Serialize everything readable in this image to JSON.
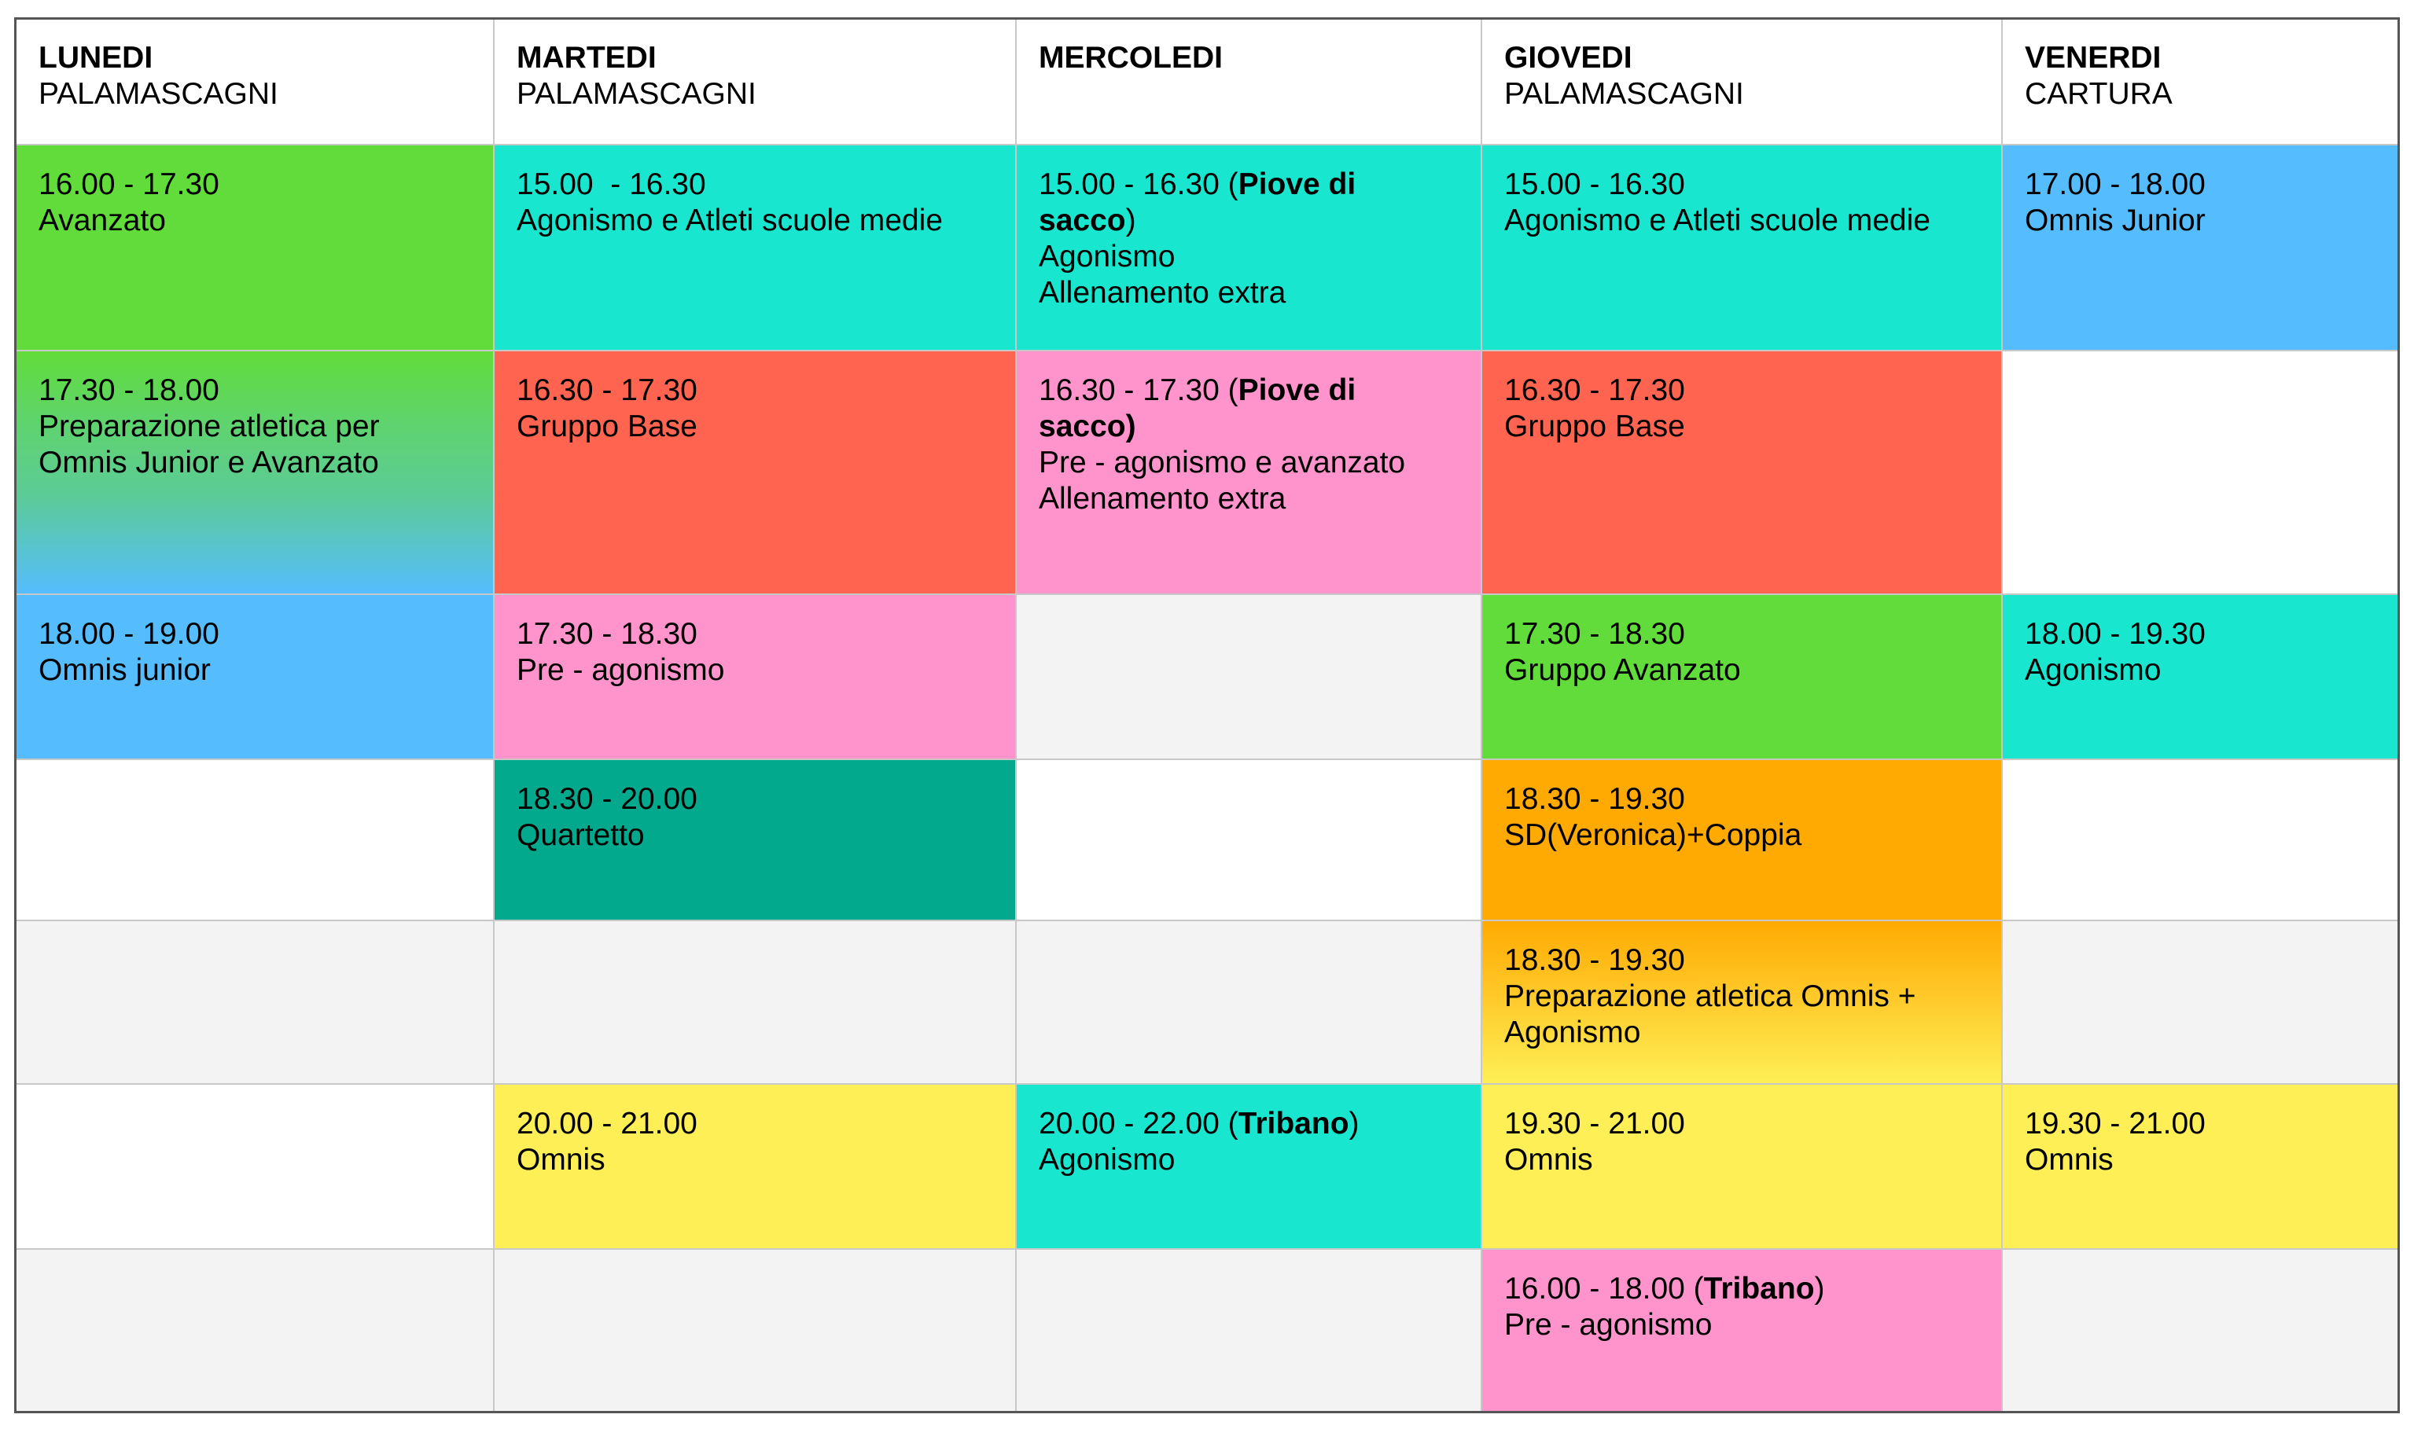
{
  "colors": {
    "green": "#61dc3a",
    "cyan": "#18e6cf",
    "blue": "#55bdfd",
    "red": "#ff6450",
    "pink": "#ff94cc",
    "teal": "#02a98c",
    "orange": "#ffaa02",
    "yellow": "#fdef55",
    "grey": "#f3f3f3",
    "white": "#ffffff",
    "grid_line": "#c8c8c8",
    "outer_border": "#555555"
  },
  "header": [
    {
      "day": "LUNEDI",
      "place": "PALAMASCAGNI"
    },
    {
      "day": "MARTEDI",
      "place": "PALAMASCAGNI"
    },
    {
      "day": "MERCOLEDI",
      "place": ""
    },
    {
      "day": "GIOVEDI",
      "place": "PALAMASCAGNI"
    },
    {
      "day": "VENERDI",
      "place": "CARTURA"
    }
  ],
  "rows": [
    [
      {
        "color": "green",
        "lines": [
          [
            {
              "t": "16.00 - 17.30"
            }
          ],
          [
            {
              "t": "Avanzato"
            }
          ]
        ]
      },
      {
        "color": "cyan",
        "lines": [
          [
            {
              "t": "15.00  - 16.30"
            }
          ],
          [
            {
              "t": "Agonismo e Atleti scuole medie"
            }
          ]
        ]
      },
      {
        "color": "cyan",
        "lines": [
          [
            {
              "t": "15.00 - 16.30 ("
            },
            {
              "t": "Piove di sacco",
              "b": true
            },
            {
              "t": ")"
            }
          ],
          [
            {
              "t": "Agonismo"
            }
          ],
          [
            {
              "t": "Allenamento extra"
            }
          ]
        ]
      },
      {
        "color": "cyan",
        "lines": [
          [
            {
              "t": "15.00 - 16.30"
            }
          ],
          [
            {
              "t": "Agonismo e Atleti scuole medie"
            }
          ]
        ]
      },
      {
        "color": "blue",
        "lines": [
          [
            {
              "t": "17.00 - 18.00"
            }
          ],
          [
            {
              "t": "Omnis Junior"
            }
          ]
        ]
      }
    ],
    [
      {
        "color": "green-blue",
        "lines": [
          [
            {
              "t": "17.30 - 18.00"
            }
          ],
          [
            {
              "t": "Preparazione atletica per Omnis Junior e Avanzato"
            }
          ]
        ]
      },
      {
        "color": "red",
        "lines": [
          [
            {
              "t": "16.30 - 17.30"
            }
          ],
          [
            {
              "t": "Gruppo Base"
            }
          ]
        ]
      },
      {
        "color": "pink",
        "lines": [
          [
            {
              "t": "16.30 - 17.30 ("
            },
            {
              "t": "Piove di sacco)",
              "b": true
            }
          ],
          [
            {
              "t": "Pre - agonismo e avanzato"
            }
          ],
          [
            {
              "t": "Allenamento extra"
            }
          ]
        ]
      },
      {
        "color": "red",
        "lines": [
          [
            {
              "t": "16.30 - 17.30"
            }
          ],
          [
            {
              "t": "Gruppo Base"
            }
          ]
        ]
      },
      {
        "color": "white",
        "lines": []
      }
    ],
    [
      {
        "color": "blue",
        "lines": [
          [
            {
              "t": "18.00 - 19.00"
            }
          ],
          [
            {
              "t": "Omnis junior"
            }
          ]
        ]
      },
      {
        "color": "pink",
        "lines": [
          [
            {
              "t": "17.30 - 18.30"
            }
          ],
          [
            {
              "t": "Pre - agonismo"
            }
          ]
        ]
      },
      {
        "color": "grey",
        "lines": []
      },
      {
        "color": "green",
        "lines": [
          [
            {
              "t": "17.30 - 18.30"
            }
          ],
          [
            {
              "t": "Gruppo Avanzato"
            }
          ]
        ]
      },
      {
        "color": "cyan",
        "lines": [
          [
            {
              "t": "18.00 - 19.30"
            }
          ],
          [
            {
              "t": "Agonismo"
            }
          ]
        ]
      }
    ],
    [
      {
        "color": "white",
        "lines": []
      },
      {
        "color": "teal",
        "lines": [
          [
            {
              "t": "18.30 - 20.00"
            }
          ],
          [
            {
              "t": "Quartetto"
            }
          ]
        ]
      },
      {
        "color": "white",
        "lines": []
      },
      {
        "color": "orange",
        "lines": [
          [
            {
              "t": "18.30 - 19.30"
            }
          ],
          [
            {
              "t": "SD(Veronica)+Coppia"
            }
          ]
        ]
      },
      {
        "color": "white",
        "lines": []
      }
    ],
    [
      {
        "color": "grey",
        "lines": []
      },
      {
        "color": "grey",
        "lines": []
      },
      {
        "color": "grey",
        "lines": []
      },
      {
        "color": "orange-yellow",
        "lines": [
          [
            {
              "t": "18.30 - 19.30"
            }
          ],
          [
            {
              "t": "Preparazione atletica Omnis + Agonismo"
            }
          ]
        ]
      },
      {
        "color": "grey",
        "lines": []
      }
    ],
    [
      {
        "color": "white",
        "lines": []
      },
      {
        "color": "yellow",
        "lines": [
          [
            {
              "t": "20.00 - 21.00"
            }
          ],
          [
            {
              "t": "Omnis"
            }
          ]
        ]
      },
      {
        "color": "cyan",
        "lines": [
          [
            {
              "t": "20.00 - 22.00 ("
            },
            {
              "t": "Tribano",
              "b": true
            },
            {
              "t": ")"
            }
          ],
          [
            {
              "t": "Agonismo"
            }
          ]
        ]
      },
      {
        "color": "yellow",
        "lines": [
          [
            {
              "t": "19.30 - 21.00"
            }
          ],
          [
            {
              "t": "Omnis"
            }
          ]
        ]
      },
      {
        "color": "yellow",
        "lines": [
          [
            {
              "t": "19.30 - 21.00"
            }
          ],
          [
            {
              "t": "Omnis"
            }
          ]
        ]
      }
    ],
    [
      {
        "color": "grey",
        "lines": []
      },
      {
        "color": "grey",
        "lines": []
      },
      {
        "color": "grey",
        "lines": []
      },
      {
        "color": "pink",
        "lines": [
          [
            {
              "t": "16.00 - 18.00 ("
            },
            {
              "t": "Tribano",
              "b": true
            },
            {
              "t": ")"
            }
          ],
          [
            {
              "t": "Pre - agonismo"
            }
          ]
        ]
      },
      {
        "color": "grey",
        "lines": []
      }
    ]
  ]
}
